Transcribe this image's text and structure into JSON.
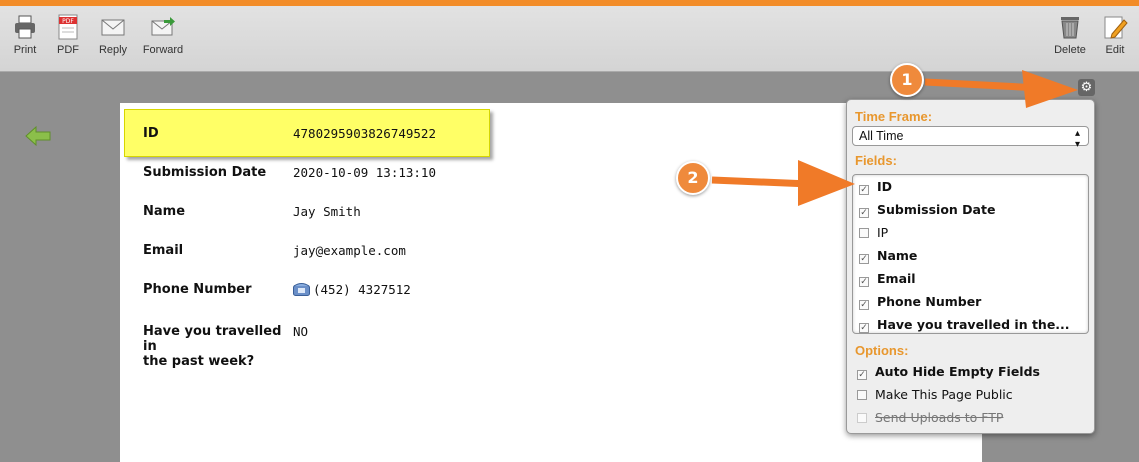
{
  "toolbar": {
    "print": "Print",
    "pdf": "PDF",
    "reply": "Reply",
    "forward": "Forward",
    "delete": "Delete",
    "edit": "Edit"
  },
  "submission": {
    "id_label": "ID",
    "id_value": "4780295903826749522",
    "date_label": "Submission Date",
    "date_value": "2020-10-09 13:13:10",
    "name_label": "Name",
    "name_value": "Jay Smith",
    "email_label": "Email",
    "email_value": "jay@example.com",
    "phone_label": "Phone Number",
    "phone_value": "(452) 4327512",
    "travel_label_line1": "Have you travelled in",
    "travel_label_line2": "the past week?",
    "travel_value": "NO"
  },
  "panel": {
    "timeframe_heading": "Time Frame:",
    "timeframe_value": "All Time",
    "fields_heading": "Fields:",
    "fields": [
      {
        "label": "ID",
        "checked": true
      },
      {
        "label": "Submission Date",
        "checked": true
      },
      {
        "label": "IP",
        "checked": false
      },
      {
        "label": "Name",
        "checked": true
      },
      {
        "label": "Email",
        "checked": true
      },
      {
        "label": "Phone Number",
        "checked": true
      },
      {
        "label": "Have you travelled in the...",
        "checked": true
      }
    ],
    "options_heading": "Options:",
    "options": [
      {
        "label": "Auto Hide Empty Fields",
        "checked": true
      },
      {
        "label": "Make This Page Public",
        "checked": false
      },
      {
        "label": "Send Uploads to FTP",
        "checked": false,
        "disabled": true
      }
    ]
  },
  "annotations": {
    "badge1": "1",
    "badge2": "2"
  },
  "colors": {
    "accent": "#f28c28",
    "highlight": "#ffff66",
    "heading": "#e8972e"
  }
}
